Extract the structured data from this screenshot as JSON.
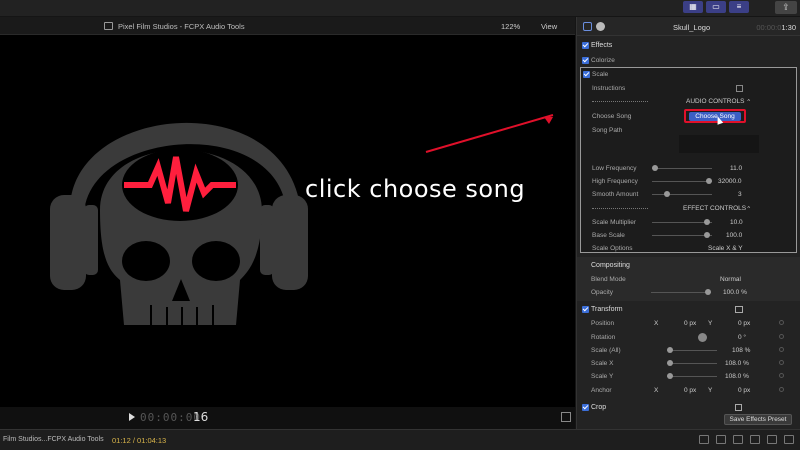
{
  "viewer": {
    "title": "Pixel Film Studios - FCPX Audio Tools",
    "zoom": "122%",
    "view_label": "View",
    "timecode_dim": "00:00:00",
    "timecode_frames": "16",
    "callout": "click choose song"
  },
  "timeline": {
    "project": "Film Studios...FCPX Audio Tools",
    "timecode": "01:12 / 01:04:13"
  },
  "inspector": {
    "clip_name": "Skull_Logo",
    "duration_prefix": "00:00:0",
    "duration": "1:30",
    "effects_label": "Effects",
    "colorize_label": "Colorize",
    "scale_label": "Scale",
    "instructions_label": "Instructions",
    "audio_controls": "AUDIO CONTROLS",
    "choose_song_label": "Choose Song",
    "choose_song_button": "Choose Song",
    "song_path_label": "Song Path",
    "low_freq_label": "Low Frequency",
    "low_freq_value": "11.0",
    "high_freq_label": "High Frequency",
    "high_freq_value": "32000.0",
    "smooth_label": "Smooth Amount",
    "smooth_value": "3",
    "effect_controls": "EFFECT CONTROLS",
    "scale_mult_label": "Scale Multiplier",
    "scale_mult_value": "10.0",
    "base_scale_label": "Base Scale",
    "base_scale_value": "100.0",
    "scale_options_label": "Scale Options",
    "scale_options_value": "Scale X & Y",
    "compositing_label": "Compositing",
    "blend_label": "Blend Mode",
    "blend_value": "Normal",
    "opacity_label": "Opacity",
    "opacity_value": "100.0 %",
    "transform_label": "Transform",
    "position_label": "Position",
    "pos_x_label": "X",
    "pos_x_value": "0 px",
    "pos_y_label": "Y",
    "pos_y_value": "0 px",
    "rotation_label": "Rotation",
    "rotation_value": "0 °",
    "scale_all_label": "Scale (All)",
    "scale_all_value": "108 %",
    "scale_x_label": "Scale X",
    "scale_x_value": "108.0 %",
    "scale_y_label": "Scale Y",
    "scale_y_value": "108.0 %",
    "anchor_label": "Anchor",
    "anchor_x_label": "X",
    "anchor_x_value": "0 px",
    "anchor_y_label": "Y",
    "anchor_y_value": "0 px",
    "crop_label": "Crop",
    "save_preset": "Save Effects Preset"
  },
  "colors": {
    "accent_blue": "#3b6ed8",
    "highlight_red": "#e0102a",
    "skull_gray": "#3a3a3a",
    "waveform_red": "#ff1f3d"
  }
}
